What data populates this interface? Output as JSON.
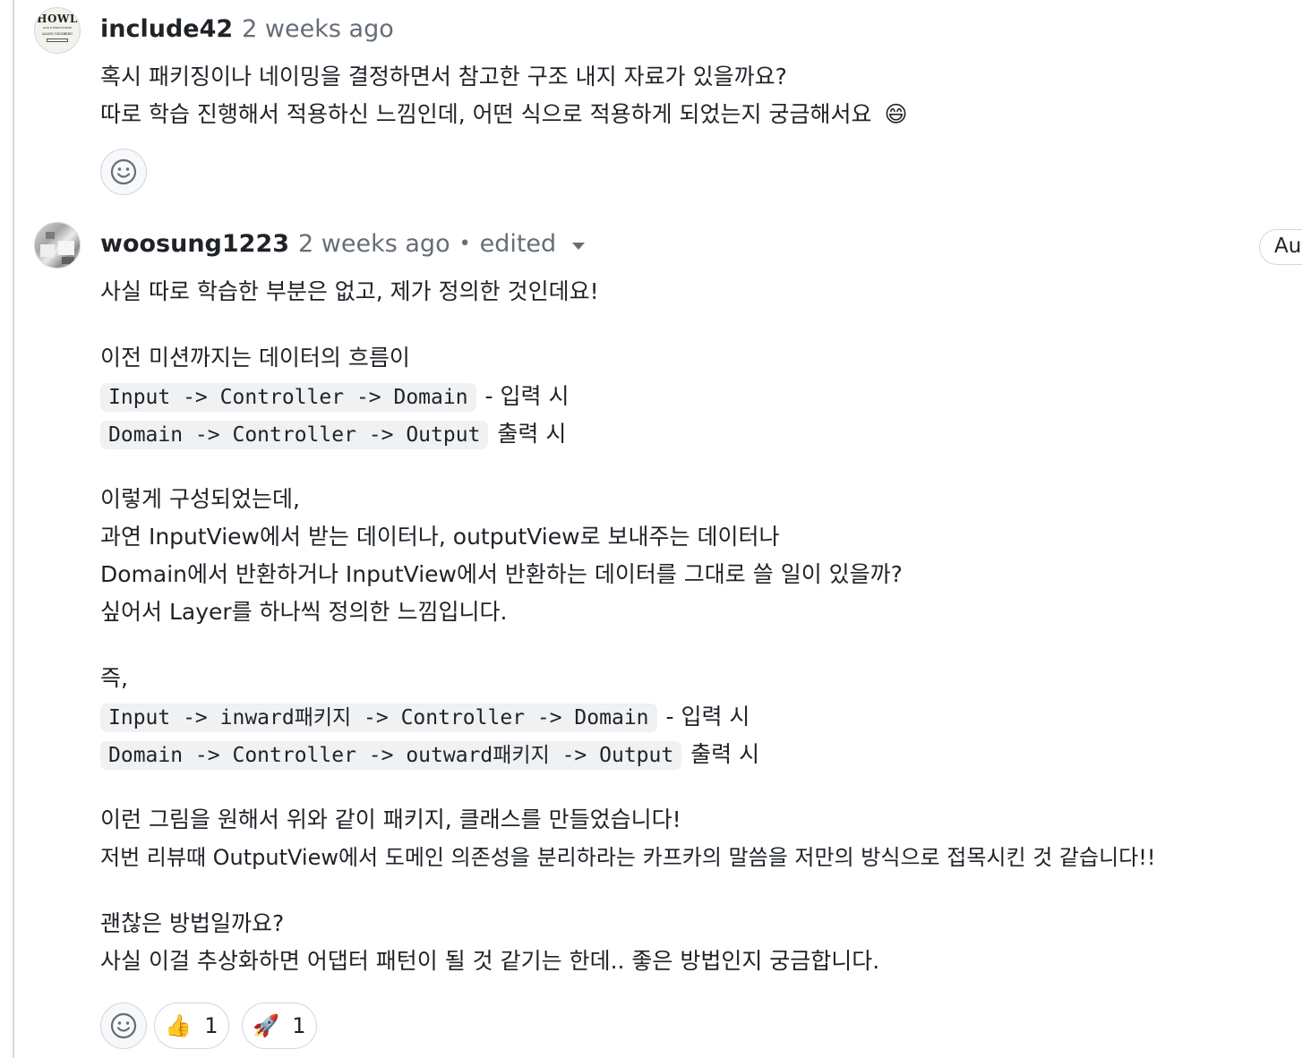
{
  "comments": [
    {
      "author": "include42",
      "time": "2 weeks ago",
      "avatar_text": [
        "HOWL",
        "AND OTHER POEMS",
        "ALLEN GINSBERG"
      ],
      "lines": [
        "혹시 패키징이나 네이밍을 결정하면서 참고한 구조 내지 자료가 있을까요?",
        "따로 학습 진행해서 적용하신 느낌인데, 어떤 식으로 적용하게 되었는지 궁금해서요"
      ],
      "emoji": "😄"
    },
    {
      "author": "woosung1223",
      "time": "2 weeks ago",
      "dot": "•",
      "edited": "edited",
      "badge": "Aut",
      "p1": "사실 따로 학습한 부분은 없고, 제가 정의한 것인데요!",
      "p2": "이전 미션까지는 데이터의 흐름이",
      "flow1_code": "Input -> Controller -> Domain",
      "flow1_text": "- 입력 시",
      "flow2_code": "Domain -> Controller -> Output",
      "flow2_text": "출력 시",
      "p3": [
        "이렇게 구성되었는데,",
        "과연 InputView에서 받는 데이터나, outputView로 보내주는 데이터나",
        "Domain에서 반환하거나 InputView에서 반환하는 데이터를 그대로 쓸 일이 있을까?",
        "싶어서 Layer를 하나씩 정의한 느낌입니다."
      ],
      "p4": "즉,",
      "flow3_code": "Input -> inward패키지 -> Controller -> Domain",
      "flow3_text": "- 입력 시",
      "flow4_code": "Domain -> Controller -> outward패키지 -> Output",
      "flow4_text": "출력 시",
      "p5": [
        "이런 그림을 원해서 위와 같이 패키지, 클래스를 만들었습니다!",
        "저번 리뷰때 OutputView에서 도메인 의존성을 분리하라는 카프카의 말씀을 저만의 방식으로 접목시킨 것 같습니다!!"
      ],
      "p6": [
        "괜찮은 방법일까요?",
        "사실 이걸 추상화하면 어댑터 패턴이 될 것 같기는 한데.. 좋은 방법인지 궁금합니다."
      ],
      "reactions": [
        {
          "emoji": "👍",
          "count": "1"
        },
        {
          "emoji": "🚀",
          "count": "1"
        }
      ]
    }
  ]
}
